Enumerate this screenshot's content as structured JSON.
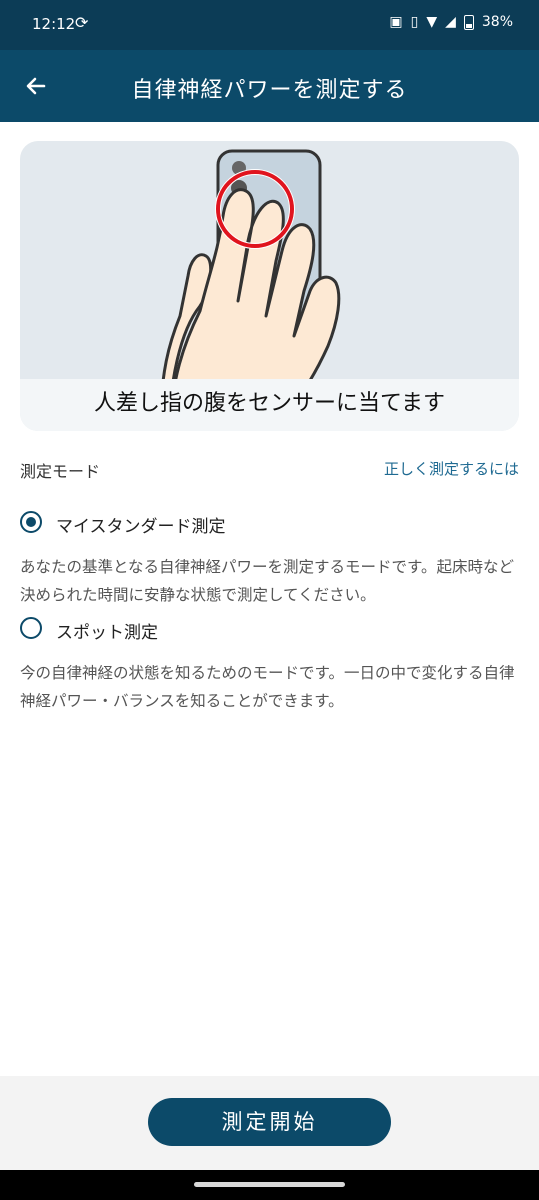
{
  "status_bar": {
    "time": "12:12",
    "battery": "38%"
  },
  "app_bar": {
    "title": "自律神経パワーを測定する"
  },
  "illustration": {
    "caption": "人差し指の腹をセンサーに当てます"
  },
  "mode": {
    "label": "測定モード",
    "help_link": "正しく測定するには"
  },
  "options": [
    {
      "label": "マイスタンダード測定",
      "selected": true,
      "description": "あなたの基準となる自律神経パワーを測定するモードです。起床時など決められた時間に安静な状態で測定してください。"
    },
    {
      "label": "スポット測定",
      "selected": false,
      "description": "今の自律神経の状態を知るためのモードです。一日の中で変化する自律神経パワー・バランスを知ることができます。"
    }
  ],
  "footer": {
    "start_button": "測定開始"
  },
  "colors": {
    "primary": "#0c4a69",
    "status_bar": "#0c3c56",
    "link": "#1f6a92",
    "highlight_ring": "#e0141e"
  }
}
